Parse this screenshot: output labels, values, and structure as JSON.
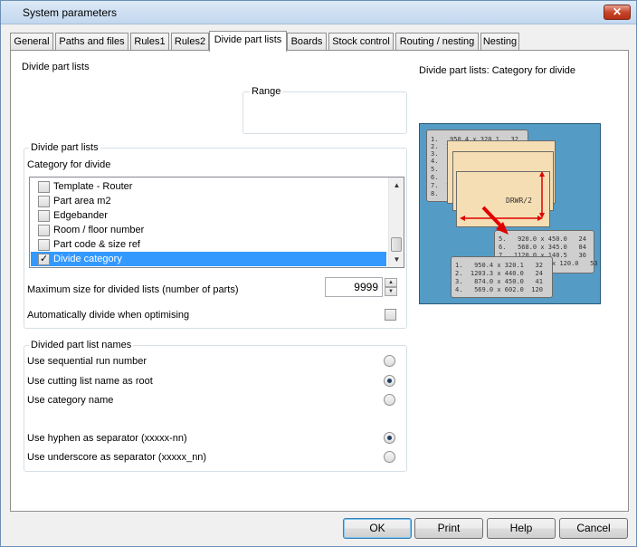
{
  "window": {
    "title": "System parameters",
    "close_glyph": "✕"
  },
  "tabs": [
    {
      "label": "General"
    },
    {
      "label": "Paths and files"
    },
    {
      "label": "Rules1"
    },
    {
      "label": "Rules2"
    },
    {
      "label": "Divide part lists"
    },
    {
      "label": "Boards"
    },
    {
      "label": "Stock control"
    },
    {
      "label": "Routing / nesting"
    },
    {
      "label": "Nesting"
    }
  ],
  "page": {
    "heading": "Divide part lists",
    "range_label": "Range",
    "preview_caption": "Divide part lists: Category for divide"
  },
  "divide_group": {
    "legend": "Divide part lists",
    "category_label": "Category for divide",
    "items": [
      {
        "label": "Template - Router",
        "checked": false
      },
      {
        "label": "Part area m2",
        "checked": false
      },
      {
        "label": "Edgebander",
        "checked": false
      },
      {
        "label": "Room / floor number",
        "checked": false
      },
      {
        "label": "Part code & size ref",
        "checked": false
      },
      {
        "label": "Divide category",
        "checked": true
      }
    ],
    "max_size_label": "Maximum size for divided lists (number of parts)",
    "max_size_value": "9999",
    "auto_divide_label": "Automatically divide when optimising",
    "auto_divide_checked": false
  },
  "names_group": {
    "legend": "Divided part list names",
    "options": [
      {
        "label": "Use sequential run number",
        "selected": false
      },
      {
        "label": "Use cutting list name as root",
        "selected": true
      },
      {
        "label": "Use category name",
        "selected": false
      }
    ],
    "separators": [
      {
        "label": "Use hyphen as separator (xxxxx-nn)",
        "selected": true
      },
      {
        "label": "Use underscore as separator (xxxxx_nn)",
        "selected": false
      }
    ]
  },
  "preview": {
    "sheet_label": "DRWR/2",
    "list_back": [
      "1.   950.4 x 320.1   32",
      "2.  1203.3 x 440.0   24",
      "3.   874.0 x 450.0   41",
      "4.   569.0 x 602.0  120",
      "5.   9",
      "6.   5",
      "7.  11",
      "8.   6"
    ],
    "list_mid": [
      "5.   920.0 x 450.0   24",
      "6.   568.0 x 345.0   84",
      "7.  1120.0 x 140.5   36",
      "8.         .0 x 120.0   53"
    ],
    "list_front": [
      "1.   950.4 x 320.1   32",
      "2.  1203.3 x 440.0   24",
      "3.   874.0 x 450.0   41",
      "4.   569.0 x 602.0  120"
    ],
    "colors": {
      "background": "#549cc6",
      "sheet": "#f5deb3",
      "arrow": "#e00000"
    }
  },
  "buttons": {
    "ok": "OK",
    "print": "Print",
    "help": "Help",
    "cancel": "Cancel"
  }
}
